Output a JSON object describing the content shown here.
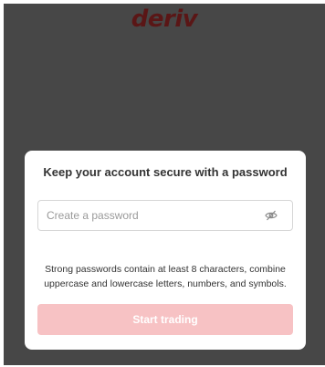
{
  "brand": {
    "logo_text": "deriv"
  },
  "modal": {
    "title": "Keep your account secure with a password",
    "password_input": {
      "placeholder": "Create a password",
      "value": ""
    },
    "hint": "Strong passwords contain at least 8 characters, combine uppercase and lowercase letters, numbers, and symbols.",
    "submit_label": "Start trading",
    "toggle_icon": "eye-off-icon"
  },
  "colors": {
    "overlay": "#474747",
    "brand": "#5a1616",
    "button_disabled": "#f7c2c4"
  }
}
